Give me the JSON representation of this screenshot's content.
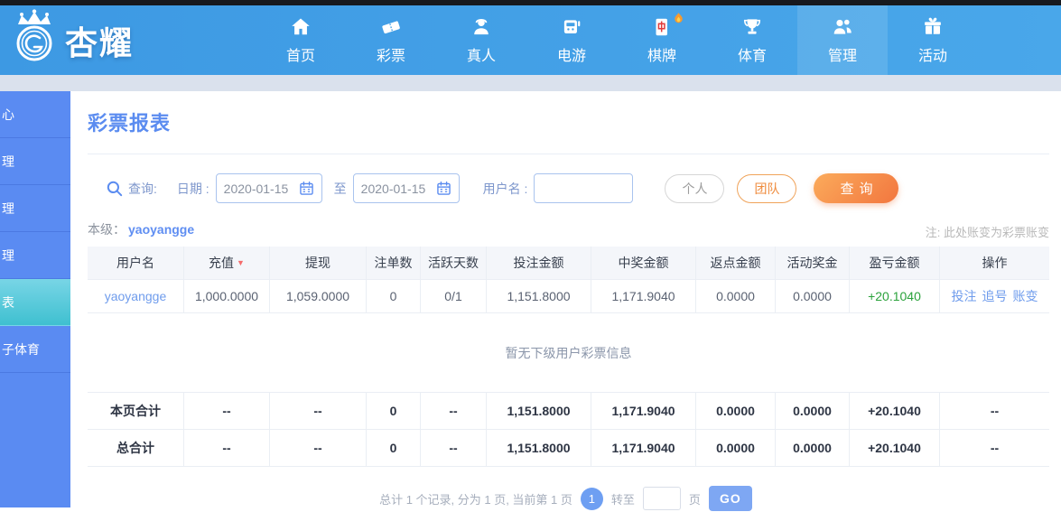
{
  "topbar": {
    "logo_text": "杏耀",
    "items": [
      {
        "label": "首页"
      },
      {
        "label": "彩票"
      },
      {
        "label": "真人"
      },
      {
        "label": "电游"
      },
      {
        "label": "棋牌"
      },
      {
        "label": "体育"
      },
      {
        "label": "管理"
      },
      {
        "label": "活动"
      }
    ]
  },
  "sidebar": {
    "items": [
      {
        "label": "心"
      },
      {
        "label": "理"
      },
      {
        "label": "理"
      },
      {
        "label": "理"
      },
      {
        "label": "表"
      },
      {
        "label": "子体育"
      }
    ]
  },
  "page": {
    "title": "彩票报表"
  },
  "search": {
    "query_label": "查询:",
    "date_label": "日期 :",
    "date_from": "2020-01-15",
    "to_label": "至",
    "date_to": "2020-01-15",
    "username_label": "用户名 :",
    "username_value": "",
    "personal_button": "个人",
    "team_button": "团队",
    "search_button": "查询"
  },
  "level": {
    "label": "本级：",
    "user": "yaoyangge",
    "note": "注: 此处账变为彩票账变"
  },
  "table": {
    "headers": [
      "用户名",
      "充值",
      "提现",
      "注单数",
      "活跃天数",
      "投注金额",
      "中奖金额",
      "返点金额",
      "活动奖金",
      "盈亏金额",
      "操作"
    ],
    "sort_arrow": "▼",
    "row": {
      "user": "yaoyangge",
      "recharge": "1,000.0000",
      "withdraw": "1,059.0000",
      "orders": "0",
      "active_days": "0/1",
      "bet": "1,151.8000",
      "win": "1,171.9040",
      "rebate": "0.0000",
      "bonus": "0.0000",
      "profit": "+20.1040",
      "actions": [
        "投注",
        "追号",
        "账变"
      ]
    },
    "empty_text": "暂无下级用户彩票信息",
    "totals": [
      {
        "label": "本页合计",
        "recharge": "--",
        "withdraw": "--",
        "orders": "0",
        "active_days": "--",
        "bet": "1,151.8000",
        "win": "1,171.9040",
        "rebate": "0.0000",
        "bonus": "0.0000",
        "profit": "+20.1040",
        "op": "--"
      },
      {
        "label": "总合计",
        "recharge": "--",
        "withdraw": "--",
        "orders": "0",
        "active_days": "--",
        "bet": "1,151.8000",
        "win": "1,171.9040",
        "rebate": "0.0000",
        "bonus": "0.0000",
        "profit": "+20.1040",
        "op": "--"
      }
    ]
  },
  "pagination": {
    "summary": "总计 1 个记录, 分为 1 页, 当前第 1 页",
    "current_page": "1",
    "goto_label": "转至",
    "page_unit": "页",
    "go_button": "GO"
  },
  "colors": {
    "nav_blue": "#43a0e6",
    "accent_blue": "#5b8cf0",
    "sidebar_blue": "#5a8bf2",
    "active_cyan": "#3fc0d0",
    "orange": "#f2763f",
    "green": "#2ba23c",
    "red": "#f56c6c"
  }
}
